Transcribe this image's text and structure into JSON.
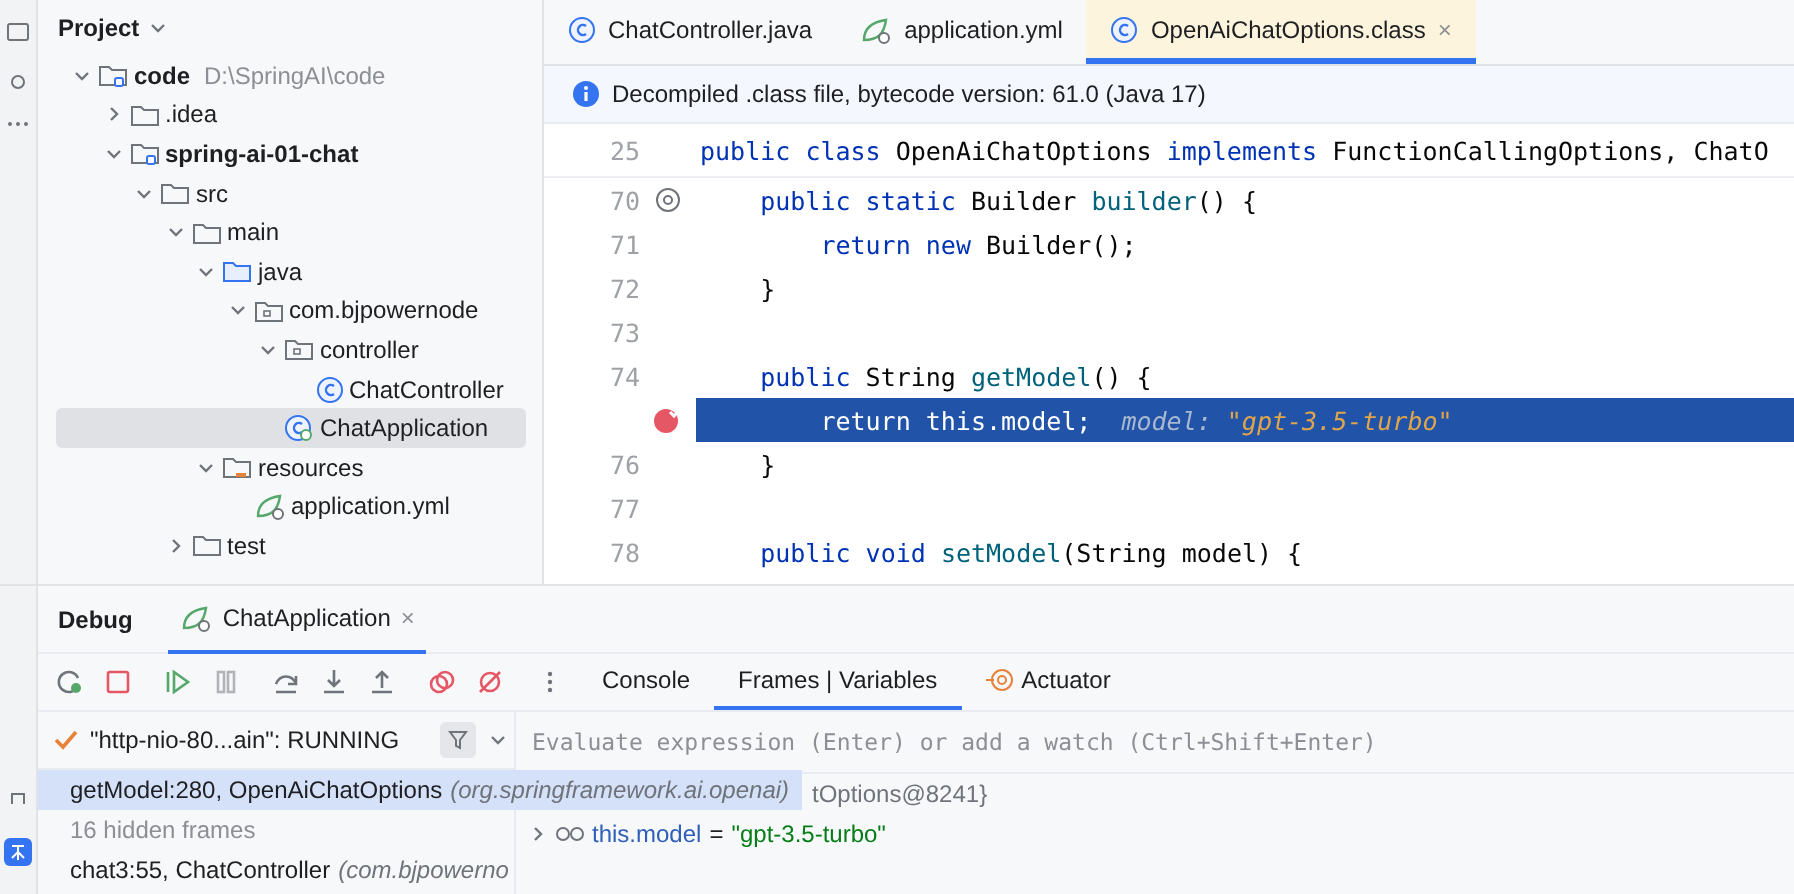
{
  "project_panel": {
    "title": "Project",
    "tree": [
      {
        "name": "code",
        "path": "D:\\SpringAI\\code",
        "kind": "module",
        "expanded": true,
        "selected": false,
        "children": [
          {
            "name": ".idea",
            "kind": "folder",
            "expanded": false,
            "selected": false
          },
          {
            "name": "spring-ai-01-chat",
            "kind": "module",
            "expanded": true,
            "selected": false,
            "children": [
              {
                "name": "src",
                "kind": "folder",
                "expanded": true,
                "selected": false,
                "children": [
                  {
                    "name": "main",
                    "kind": "folder",
                    "expanded": true,
                    "selected": false,
                    "children": [
                      {
                        "name": "java",
                        "kind": "source",
                        "expanded": true,
                        "selected": false,
                        "children": [
                          {
                            "name": "com.bjpowernode",
                            "kind": "package",
                            "expanded": true,
                            "selected": false,
                            "children": [
                              {
                                "name": "controller",
                                "kind": "package",
                                "expanded": true,
                                "selected": false,
                                "children": [
                                  {
                                    "name": "ChatController",
                                    "kind": "class",
                                    "selected": false
                                  }
                                ]
                              },
                              {
                                "name": "ChatApplication",
                                "kind": "app",
                                "selected": true
                              }
                            ]
                          }
                        ]
                      },
                      {
                        "name": "resources",
                        "kind": "resources",
                        "expanded": true,
                        "selected": false,
                        "children": [
                          {
                            "name": "application.yml",
                            "kind": "yml",
                            "selected": false
                          }
                        ]
                      }
                    ]
                  },
                  {
                    "name": "test",
                    "kind": "folder",
                    "expanded": false,
                    "selected": false
                  }
                ]
              }
            ]
          }
        ]
      }
    ]
  },
  "editor": {
    "tabs": [
      {
        "label": "ChatController.java",
        "kind": "class",
        "selected": false
      },
      {
        "label": "application.yml",
        "kind": "yml",
        "selected": false
      },
      {
        "label": "OpenAiChatOptions.class",
        "kind": "class",
        "selected": true,
        "close": "×"
      }
    ],
    "banner": "Decompiled .class file, bytecode version: 61.0 (Java 17)",
    "sticky_line": {
      "number": "25",
      "tokens": [
        {
          "t": "public ",
          "kind": "kw"
        },
        {
          "t": "class ",
          "kind": "kw"
        },
        {
          "t": "OpenAiChatOptions ",
          "kind": "plain"
        },
        {
          "t": "implements ",
          "kind": "kw"
        },
        {
          "t": "FunctionCallingOptions, ChatO",
          "kind": "plain"
        }
      ]
    },
    "lines": [
      {
        "number": "70",
        "kind": "override",
        "current": false,
        "tokens": [
          {
            "t": "    public ",
            "kind": "kw"
          },
          {
            "t": "static ",
            "kind": "kw"
          },
          {
            "t": "Builder ",
            "kind": "plain"
          },
          {
            "t": "builder",
            "kind": "fn"
          },
          {
            "t": "() {",
            "kind": "plain"
          }
        ]
      },
      {
        "number": "71",
        "kind": "plain",
        "current": false,
        "tokens": [
          {
            "t": "        return ",
            "kind": "kw"
          },
          {
            "t": "new ",
            "kind": "kw"
          },
          {
            "t": "Builder();",
            "kind": "plain"
          }
        ]
      },
      {
        "number": "72",
        "kind": "plain",
        "current": false,
        "tokens": [
          {
            "t": "    }",
            "kind": "plain"
          }
        ]
      },
      {
        "number": "73",
        "kind": "plain",
        "current": false
      },
      {
        "number": "74",
        "kind": "plain",
        "current": false,
        "tokens": [
          {
            "t": "    public ",
            "kind": "kw"
          },
          {
            "t": "String ",
            "kind": "plain"
          },
          {
            "t": "getModel",
            "kind": "fn"
          },
          {
            "t": "() {",
            "kind": "plain"
          }
        ]
      },
      {
        "kind": "breakpoint",
        "current": true,
        "tokens": [
          {
            "t": "        return this.model;",
            "kind": "plain"
          },
          {
            "t": "  model: ",
            "kind": "hintlabel"
          },
          {
            "t": "\"gpt-3.5-turbo\"",
            "kind": "hintvalue"
          }
        ]
      },
      {
        "number": "76",
        "kind": "plain",
        "current": false,
        "tokens": [
          {
            "t": "    }",
            "kind": "plain"
          }
        ]
      },
      {
        "number": "77",
        "kind": "plain",
        "current": false
      },
      {
        "number": "78",
        "kind": "plain",
        "current": false,
        "tokens": [
          {
            "t": "    public ",
            "kind": "kw"
          },
          {
            "t": "void ",
            "kind": "kw"
          },
          {
            "t": "setModel",
            "kind": "fn"
          },
          {
            "t": "(String model) {",
            "kind": "plain"
          }
        ]
      }
    ]
  },
  "debug": {
    "title": "Debug",
    "session": {
      "label": "ChatApplication",
      "close": "×"
    },
    "toolbar": [
      {
        "kind": "rerun"
      },
      {
        "kind": "stop"
      },
      {
        "kind": "resume"
      },
      {
        "kind": "pause"
      },
      {
        "kind": "step-over"
      },
      {
        "kind": "step-into"
      },
      {
        "kind": "step-out"
      },
      {
        "kind": "breakpoints"
      },
      {
        "kind": "mute"
      },
      {
        "kind": "more"
      }
    ],
    "tabs": [
      {
        "label": "Console",
        "kind": "plain",
        "selected": false
      },
      {
        "label": "Frames | Variables",
        "kind": "plain",
        "selected": true
      },
      {
        "label": "Actuator",
        "kind": "tool",
        "selected": false
      }
    ],
    "thread": "\"http-nio-80...ain\": RUNNING",
    "frames": [
      {
        "kind": "frame",
        "method": "getModel:280, OpenAiChatOptions",
        "pkg": "(org.springframework.ai.openai)",
        "selected": true
      },
      {
        "kind": "hidden",
        "method": "16 hidden frames",
        "selected": false
      },
      {
        "kind": "frame",
        "method": "chat3:55, ChatController",
        "pkg": "(com.bjpowerno",
        "selected": false
      }
    ],
    "evaluate_placeholder": "Evaluate expression (Enter) or add a watch (Ctrl+Shift+Enter)",
    "variables": [
      {
        "kind": "tail",
        "text": "tOptions@8241}"
      },
      {
        "kind": "var",
        "name": "this.model",
        "eq": "=",
        "value": "\"gpt-3.5-turbo\""
      }
    ]
  }
}
